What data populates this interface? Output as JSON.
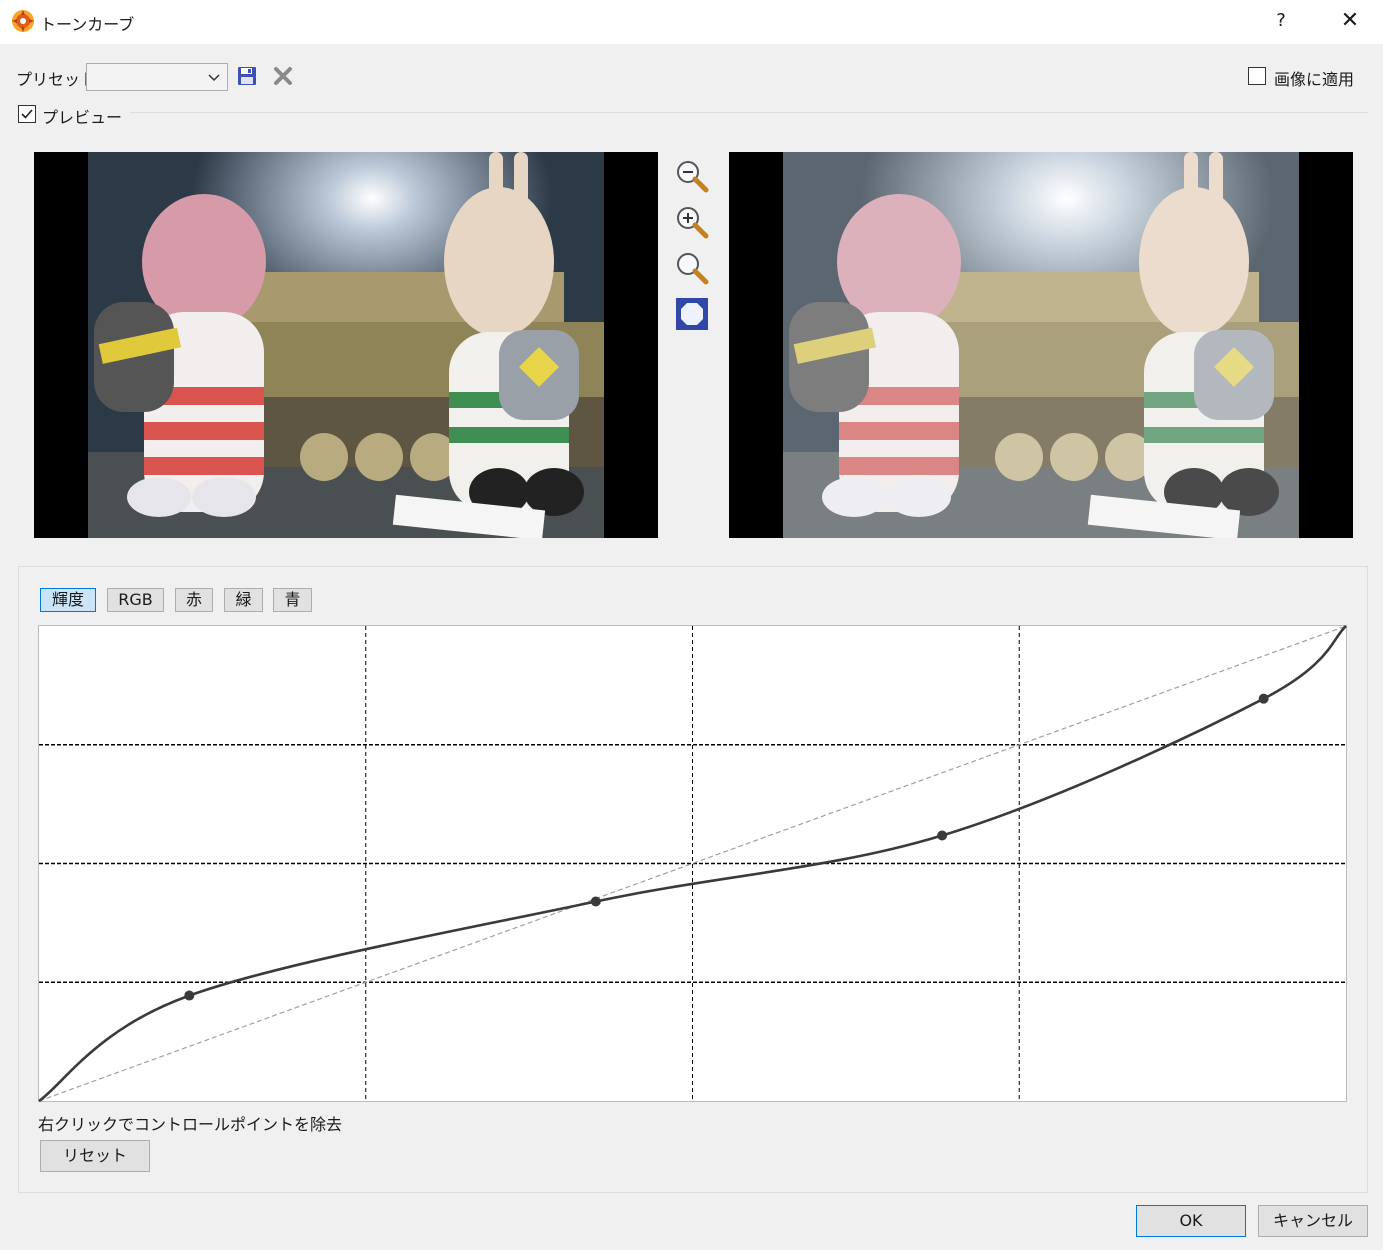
{
  "window": {
    "title": "トーンカーブ",
    "help": "?",
    "close": "✕"
  },
  "toolbar": {
    "preset_label": "プリセット:",
    "preset_value": "",
    "apply_to_image": "画像に適用",
    "apply_checked": false
  },
  "preview": {
    "label": "プレビュー",
    "checked": true
  },
  "tabs": [
    {
      "label": "輝度",
      "active": true
    },
    {
      "label": "RGB",
      "active": false
    },
    {
      "label": "赤",
      "active": false
    },
    {
      "label": "緑",
      "active": false
    },
    {
      "label": "青",
      "active": false
    }
  ],
  "curve": {
    "control_points": [
      [
        0,
        0
      ],
      [
        0.115,
        0.222
      ],
      [
        0.426,
        0.42
      ],
      [
        0.691,
        0.559
      ],
      [
        0.937,
        0.847
      ],
      [
        1,
        1
      ]
    ],
    "grid_divisions": 4,
    "colors": {
      "curve": "#3a3a3a",
      "diagonal": "#a0a0a0",
      "grid": "#000000"
    }
  },
  "hint": "右クリックでコントロールポイントを除去",
  "buttons": {
    "reset": "リセット",
    "ok": "OK",
    "cancel": "キャンセル"
  },
  "icons": [
    "app-logo-icon",
    "dropdown-chevron-icon",
    "save-icon",
    "delete-icon",
    "zoom-out-icon",
    "zoom-in-icon",
    "zoom-actual-icon",
    "fit-to-window-icon"
  ]
}
